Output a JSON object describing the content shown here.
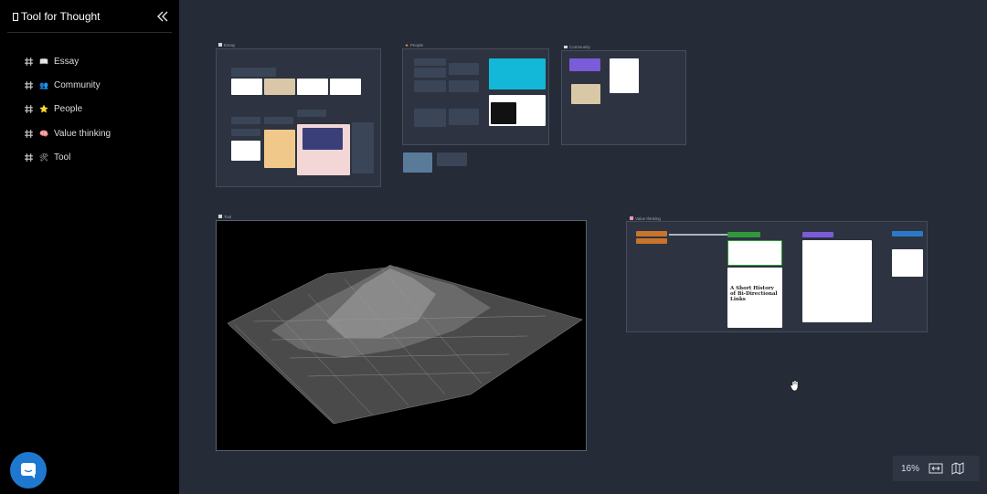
{
  "app": {
    "title": "Tool for Thought",
    "title_icon": "box-glyph-icon"
  },
  "sidebar": {
    "items": [
      {
        "emoji": "📖",
        "label": "Essay"
      },
      {
        "emoji": "👥",
        "label": "Community"
      },
      {
        "emoji": "⭐",
        "label": "People"
      },
      {
        "emoji": "🧠",
        "label": "Value thinking"
      },
      {
        "emoji": "🛠",
        "label": "Tool"
      }
    ]
  },
  "canvas": {
    "boards": {
      "essay": {
        "title": "Essay"
      },
      "people": {
        "title": "People"
      },
      "community": {
        "title": "Community"
      },
      "tool": {
        "title": "Tool"
      },
      "value_thinking": {
        "title": "Value thinking",
        "article_title": "A Short History of Bi-Directional Links"
      }
    }
  },
  "zoom": {
    "level": "16%"
  },
  "colors": {
    "accent_blue": "#1f78cf",
    "canvas_bg": "#252b37",
    "sidebar_bg": "#000000"
  }
}
